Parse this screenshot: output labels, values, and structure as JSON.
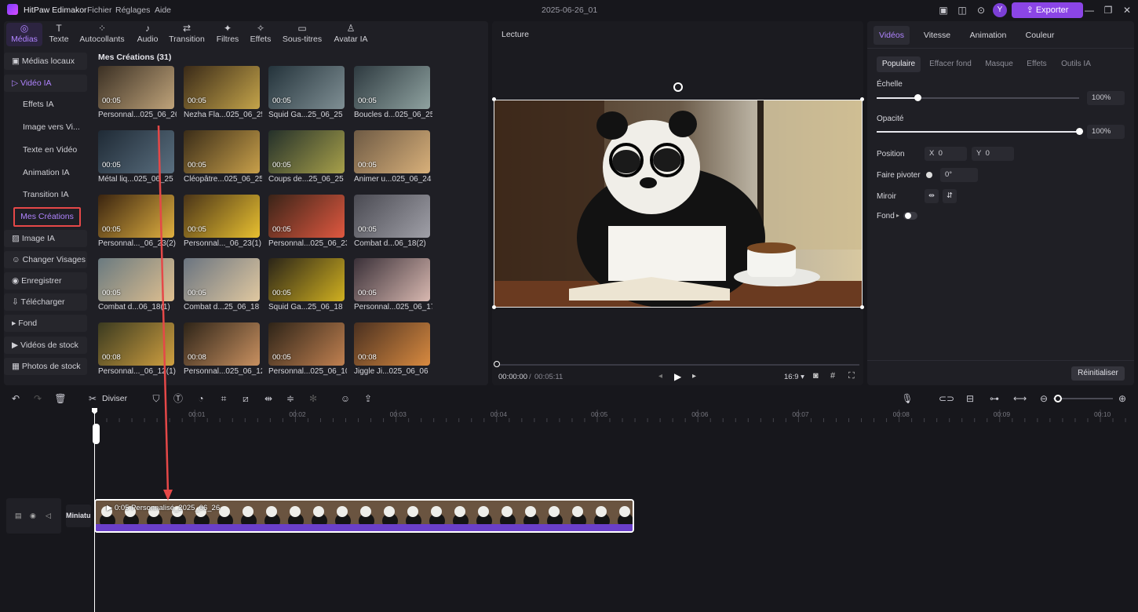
{
  "app": {
    "name": "HitPaw Edimakor",
    "menu": [
      "Fichier",
      "Réglages",
      "Aide"
    ],
    "document_title": "2025-06-26_01",
    "avatar_letter": "Y",
    "export_label": "Exporter"
  },
  "media_tabs": [
    "Médias",
    "Texte",
    "Autocollants",
    "Audio",
    "Transition",
    "Filtres",
    "Effets",
    "Sous-titres",
    "Avatar IA"
  ],
  "sidebar": {
    "items": [
      {
        "label": "Médias locaux"
      },
      {
        "label": "Vidéo IA"
      }
    ],
    "sub_items": [
      "Effets IA",
      "Image vers Vi...",
      "Texte en Vidéo",
      "Animation IA",
      "Transition IA"
    ],
    "selected": "Mes Créations",
    "bottom_items": [
      "Image IA",
      "Changer Visages",
      "Enregistrer",
      "Télécharger",
      "Fond",
      "Vidéos de stock",
      "Photos de stock"
    ]
  },
  "grid": {
    "title": "Mes Créations (31)",
    "items": [
      {
        "label": "Personnal...025_06_26",
        "duration": "00:05",
        "c1": "#3b3024",
        "c2": "#bfa37a"
      },
      {
        "label": "Nezha Fla...025_06_25",
        "duration": "00:05",
        "c1": "#3a2a18",
        "c2": "#c4a44a"
      },
      {
        "label": "Squid Ga...25_06_25",
        "duration": "00:05",
        "c1": "#24333b",
        "c2": "#7f8f94"
      },
      {
        "label": "Boucles d...025_06_25",
        "duration": "00:05",
        "c1": "#2e3a40",
        "c2": "#8fa2a0"
      },
      {
        "label": "Métal liq...025_06_25",
        "duration": "00:05",
        "c1": "#1f2a35",
        "c2": "#5a6f80"
      },
      {
        "label": "Cléopâtre...025_06_25",
        "duration": "00:05",
        "c1": "#3a2c18",
        "c2": "#c8a04a"
      },
      {
        "label": "Coups de...25_06_25",
        "duration": "00:05",
        "c1": "#24302a",
        "c2": "#a7a04a"
      },
      {
        "label": "Animer u...025_06_24",
        "duration": "00:05",
        "c1": "#6e5a44",
        "c2": "#d8b07a"
      },
      {
        "label": "Personnal..._06_23(2)",
        "duration": "00:05",
        "c1": "#3a2410",
        "c2": "#e0b040"
      },
      {
        "label": "Personnal..._06_23(1)",
        "duration": "00:05",
        "c1": "#4a3418",
        "c2": "#e8c030"
      },
      {
        "label": "Personnal...025_06_23",
        "duration": "00:05",
        "c1": "#3a2418",
        "c2": "#e05840"
      },
      {
        "label": "Combat d...06_18(2)",
        "duration": "00:05",
        "c1": "#4a4a52",
        "c2": "#a0a0a8"
      },
      {
        "label": "Combat d...06_18(1)",
        "duration": "00:05",
        "c1": "#6a7a80",
        "c2": "#e0c090"
      },
      {
        "label": "Combat d...25_06_18",
        "duration": "00:05",
        "c1": "#6a7480",
        "c2": "#e0c8a0"
      },
      {
        "label": "Squid Ga...25_06_18",
        "duration": "00:05",
        "c1": "#2a2418",
        "c2": "#d0b020"
      },
      {
        "label": "Personnal...025_06_17",
        "duration": "00:05",
        "c1": "#3a3038",
        "c2": "#d8b8b0"
      },
      {
        "label": "Personnal..._06_12(1)",
        "duration": "00:08",
        "c1": "#3a3a20",
        "c2": "#d0a040"
      },
      {
        "label": "Personnal...025_06_12",
        "duration": "00:08",
        "c1": "#2e2418",
        "c2": "#c89060"
      },
      {
        "label": "Personnal...025_06_10",
        "duration": "00:05",
        "c1": "#2e2418",
        "c2": "#c08050"
      },
      {
        "label": "Jiggle Ji...025_06_06",
        "duration": "00:08",
        "c1": "#4a3020",
        "c2": "#d88a40"
      }
    ]
  },
  "viewer": {
    "title": "Lecture",
    "current_time": "00:00:00",
    "separator": "/",
    "total_time": "00:05:11",
    "aspect": "16:9 ▾"
  },
  "properties": {
    "tabs": [
      "Vidéos",
      "Vitesse",
      "Animation",
      "Couleur"
    ],
    "subtabs": [
      "Populaire",
      "Effacer fond",
      "Masque",
      "Effets",
      "Outils IA"
    ],
    "scale_label": "Échelle",
    "scale_value": "100%",
    "scale_level": 0.2,
    "opacity_label": "Opacité",
    "opacity_value": "100%",
    "opacity_level": 1.0,
    "position_label": "Position",
    "pos_x_label": "X",
    "pos_x": "0",
    "pos_y_label": "Y",
    "pos_y": "0",
    "rotate_label": "Faire pivoter",
    "rotate_value": "0°",
    "mirror_label": "Miroir",
    "background_label": "Fond",
    "reset_label": "Réinitialiser"
  },
  "timeline": {
    "split_label": "Diviser",
    "ticks": [
      "00:01",
      "00:02",
      "00:03",
      "00:04",
      "00:05",
      "00:06",
      "00:07",
      "00:08",
      "00:09",
      "00:10"
    ],
    "track_name": "Miniatur",
    "clip_label": "0:05 Personnalisé_2025_06_26"
  },
  "colors": {
    "accent": "#8b45e6",
    "accent_text": "#b084ff",
    "highlight_box": "#e54848",
    "arrow": "#e54848",
    "clip_bar": "#6a3fc9"
  }
}
